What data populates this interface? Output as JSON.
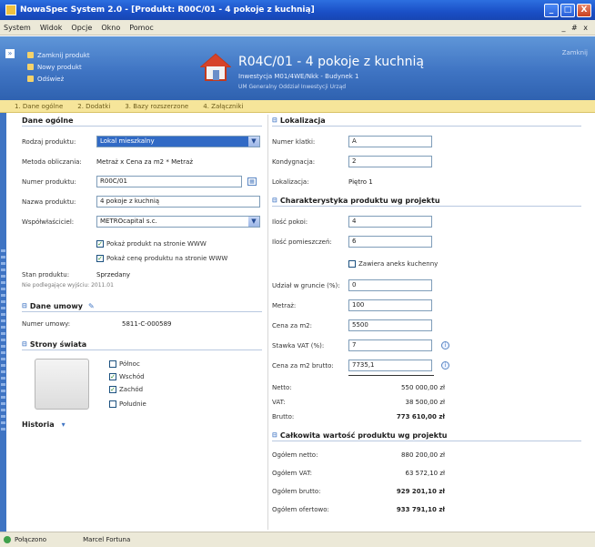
{
  "window": {
    "title": "NowaSpec System 2.0 - [Produkt: R00C/01 - 4 pokoje z kuchnią]",
    "minimize": "_",
    "maximize": "□",
    "close": "X"
  },
  "menu": {
    "items": [
      "System",
      "Widok",
      "Opcje",
      "Okno",
      "Pomoc"
    ],
    "mdi_controls": "_ # x"
  },
  "header": {
    "collapse": "»",
    "quick_links": [
      "Zamknij produkt",
      "Nowy produkt",
      "Odśwież"
    ],
    "title": "R04C/01 - 4 pokoje z kuchnią",
    "subtitle1": "Inwestycja M01/4WE/Nkk - Budynek 1",
    "subtitle2": "UM Generalny Oddział Inwestycji Urząd",
    "right_text": "Zamknij"
  },
  "tabs": [
    "1. Dane ogólne",
    "2. Dodatki",
    "3. Bazy rozszerzone",
    "4. Załączniki"
  ],
  "left": {
    "section_general": "Dane ogólne",
    "fields": {
      "product_type_label": "Rodzaj produktu:",
      "product_type_value": "Lokal mieszkalny",
      "calc_method_label": "Metoda obliczania:",
      "calc_method_value": "Metraż x Cena za m2 * Metraż",
      "product_number_label": "Numer produktu:",
      "product_number_value": "R00C/01",
      "product_name_label": "Nazwa produktu:",
      "product_name_value": "4 pokoje z kuchnią",
      "coowner_label": "Współwłaściciel:",
      "coowner_value": "METROcapital s.c.",
      "check_show_web": "Pokaż produkt na stronie WWW",
      "check_show_price": "Pokaż cenę produktu na stronie WWW",
      "status_label": "Stan produktu:",
      "status_value": "Sprzedany",
      "status_note": "Nie podlegające wyjściu: 2011.01"
    },
    "section_contract": "Dane umowy",
    "contract_number_label": "Numer umowy:",
    "contract_number_value": "5811-C-000589",
    "section_world": "Strony świata",
    "directions": [
      {
        "label": "Północ",
        "checked": false
      },
      {
        "label": "Wschód",
        "checked": true
      },
      {
        "label": "Zachód",
        "checked": true
      },
      {
        "label": "Południe",
        "checked": false
      }
    ],
    "section_history": "Historia"
  },
  "right": {
    "section_location": "Lokalizacja",
    "building_label": "Numer klatki:",
    "building_value": "A",
    "floor_label": "Kondygnacja:",
    "floor_value": "2",
    "location_label": "Lokalizacja:",
    "location_value": "Piętro 1",
    "section_project": "Charakterystyka produktu wg projektu",
    "rooms_label": "Ilość pokoi:",
    "rooms_value": "4",
    "rooms2_label": "Ilość pomieszczeń:",
    "rooms2_value": "6",
    "kitchen_check": "Zawiera aneks kuchenny",
    "share_label": "Udział w gruncie (%):",
    "share_value": "0",
    "area_label": "Metraż:",
    "area_value": "100",
    "price_m2_label": "Cena za m2:",
    "price_m2_value": "5500",
    "vat_label": "Stawka VAT (%):",
    "vat_value": "7",
    "price_gross_m2_label": "Cena za m2 brutto:",
    "price_gross_m2_value": "7735,1",
    "net_label": "Netto:",
    "net_value": "550 000,00 zł",
    "vat_amount_label": "VAT:",
    "vat_amount_value": "38 500,00 zł",
    "gross_label": "Brutto:",
    "gross_value": "773 610,00 zł",
    "section_total": "Całkowita wartość produktu wg projektu",
    "total_net_label": "Ogółem netto:",
    "total_net_value": "880 200,00 zł",
    "total_vat_label": "Ogółem VAT:",
    "total_vat_value": "63 572,10 zł",
    "total_gross_label": "Ogółem brutto:",
    "total_gross_value": "929 201,10 zł",
    "total_other_label": "Ogółem ofertowo:",
    "total_other_value": "933 791,10 zł"
  },
  "status": {
    "connected": "Połączono",
    "user": "Marcel Fortuna"
  }
}
